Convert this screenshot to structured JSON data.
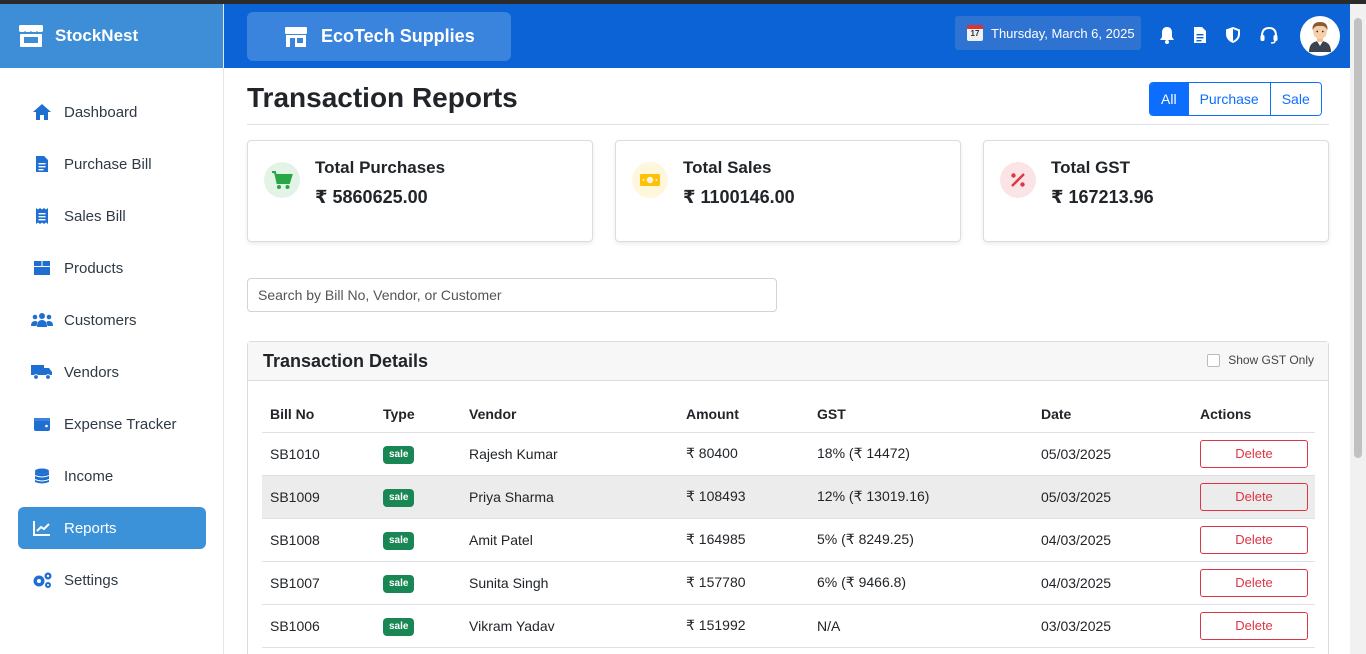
{
  "app": {
    "name": "StockNest"
  },
  "header": {
    "store_name": "EcoTech Supplies",
    "date": "Thursday, March 6, 2025",
    "calendar_day": "17",
    "icons": [
      "bell-icon",
      "document-icon",
      "shield-icon",
      "headset-icon"
    ]
  },
  "sidebar": {
    "items": [
      {
        "label": "Dashboard",
        "icon": "home-icon"
      },
      {
        "label": "Purchase Bill",
        "icon": "file-icon"
      },
      {
        "label": "Sales Bill",
        "icon": "receipt-icon"
      },
      {
        "label": "Products",
        "icon": "box-icon"
      },
      {
        "label": "Customers",
        "icon": "users-icon"
      },
      {
        "label": "Vendors",
        "icon": "truck-icon"
      },
      {
        "label": "Expense Tracker",
        "icon": "wallet-icon"
      },
      {
        "label": "Income",
        "icon": "coins-icon"
      },
      {
        "label": "Reports",
        "icon": "chart-icon",
        "active": true
      },
      {
        "label": "Settings",
        "icon": "gears-icon"
      }
    ]
  },
  "page": {
    "title": "Transaction Reports",
    "filters": [
      "All",
      "Purchase",
      "Sale"
    ],
    "active_filter": "All"
  },
  "summary": {
    "purchases": {
      "label": "Total Purchases",
      "value": "₹ 5860625.00",
      "color": "#28a745"
    },
    "sales": {
      "label": "Total Sales",
      "value": "₹ 1100146.00",
      "color": "#ffc107"
    },
    "gst": {
      "label": "Total GST",
      "value": "₹ 167213.96",
      "color": "#dc3545"
    }
  },
  "search": {
    "placeholder": "Search by Bill No, Vendor, or Customer",
    "value": ""
  },
  "details": {
    "title": "Transaction Details",
    "gst_only_label": "Show GST Only",
    "gst_only_checked": false,
    "columns": [
      "Bill No",
      "Type",
      "Vendor",
      "Amount",
      "GST",
      "Date",
      "Actions"
    ],
    "delete_label": "Delete",
    "rows": [
      {
        "bill_no": "SB1010",
        "type": "sale",
        "vendor": "Rajesh Kumar",
        "amount": "₹ 80400",
        "gst": "18% (₹ 14472)",
        "date": "05/03/2025"
      },
      {
        "bill_no": "SB1009",
        "type": "sale",
        "vendor": "Priya Sharma",
        "amount": "₹ 108493",
        "gst": "12% (₹ 13019.16)",
        "date": "05/03/2025"
      },
      {
        "bill_no": "SB1008",
        "type": "sale",
        "vendor": "Amit Patel",
        "amount": "₹ 164985",
        "gst": "5% (₹ 8249.25)",
        "date": "04/03/2025"
      },
      {
        "bill_no": "SB1007",
        "type": "sale",
        "vendor": "Sunita Singh",
        "amount": "₹ 157780",
        "gst": "6% (₹ 9466.8)",
        "date": "04/03/2025"
      },
      {
        "bill_no": "SB1006",
        "type": "sale",
        "vendor": "Vikram Yadav",
        "amount": "₹ 151992",
        "gst": "N/A",
        "date": "03/03/2025"
      }
    ]
  },
  "colors": {
    "brand": "#3d8ed6",
    "header": "#0c63d6",
    "primary": "#0d6efd",
    "danger": "#dc3545",
    "success": "#198754"
  }
}
